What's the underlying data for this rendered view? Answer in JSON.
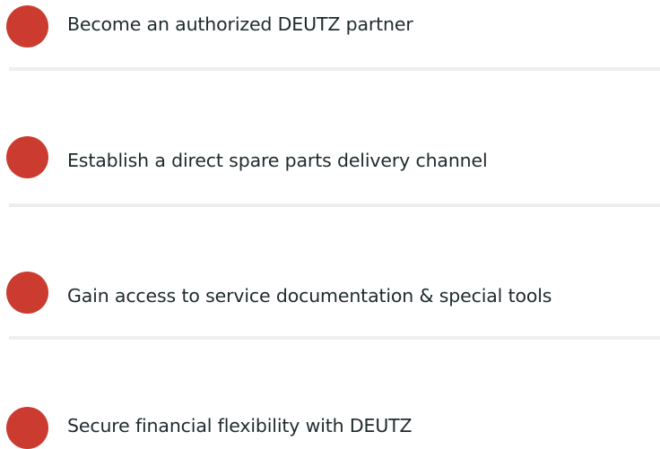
{
  "benefits": {
    "items": [
      {
        "label": "Become an authorized DEUTZ partner"
      },
      {
        "label": "Establish a direct spare parts delivery channel"
      },
      {
        "label": "Gain access to service documentation & special tools"
      },
      {
        "label": "Secure financial flexibility with DEUTZ"
      }
    ]
  },
  "colors": {
    "bullet": "#cc3b2f",
    "text": "#1f2a2d",
    "divider": "#eeeeee",
    "background": "#ffffff"
  }
}
